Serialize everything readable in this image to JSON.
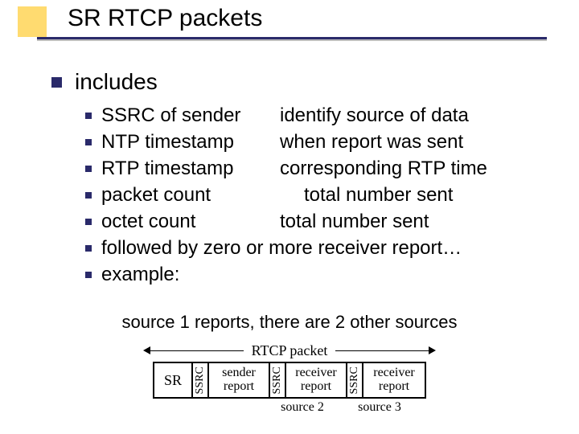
{
  "title": "SR RTCP packets",
  "section_heading": "includes",
  "bullets": [
    {
      "left": "SSRC of sender",
      "right": "identify source of data"
    },
    {
      "left": "NTP timestamp",
      "right": "when report was sent"
    },
    {
      "left": "RTP timestamp",
      "right": "corresponding RTP time"
    },
    {
      "left": "packet count",
      "right": "total number sent",
      "wide": true
    },
    {
      "left": "octet count",
      "right": "total number sent"
    },
    {
      "full": "followed by zero or more receiver report…"
    },
    {
      "full": "example:"
    }
  ],
  "caption": "source 1 reports, there are 2 other sources",
  "diagram": {
    "span_label": "RTCP packet",
    "cells": {
      "sr": "SR",
      "ssrc": "SSRC",
      "sender_line1": "sender",
      "sender_line2": "report",
      "receiver_line1": "receiver",
      "receiver_line2": "report"
    },
    "source_labels": [
      "source 2",
      "source 3"
    ]
  }
}
